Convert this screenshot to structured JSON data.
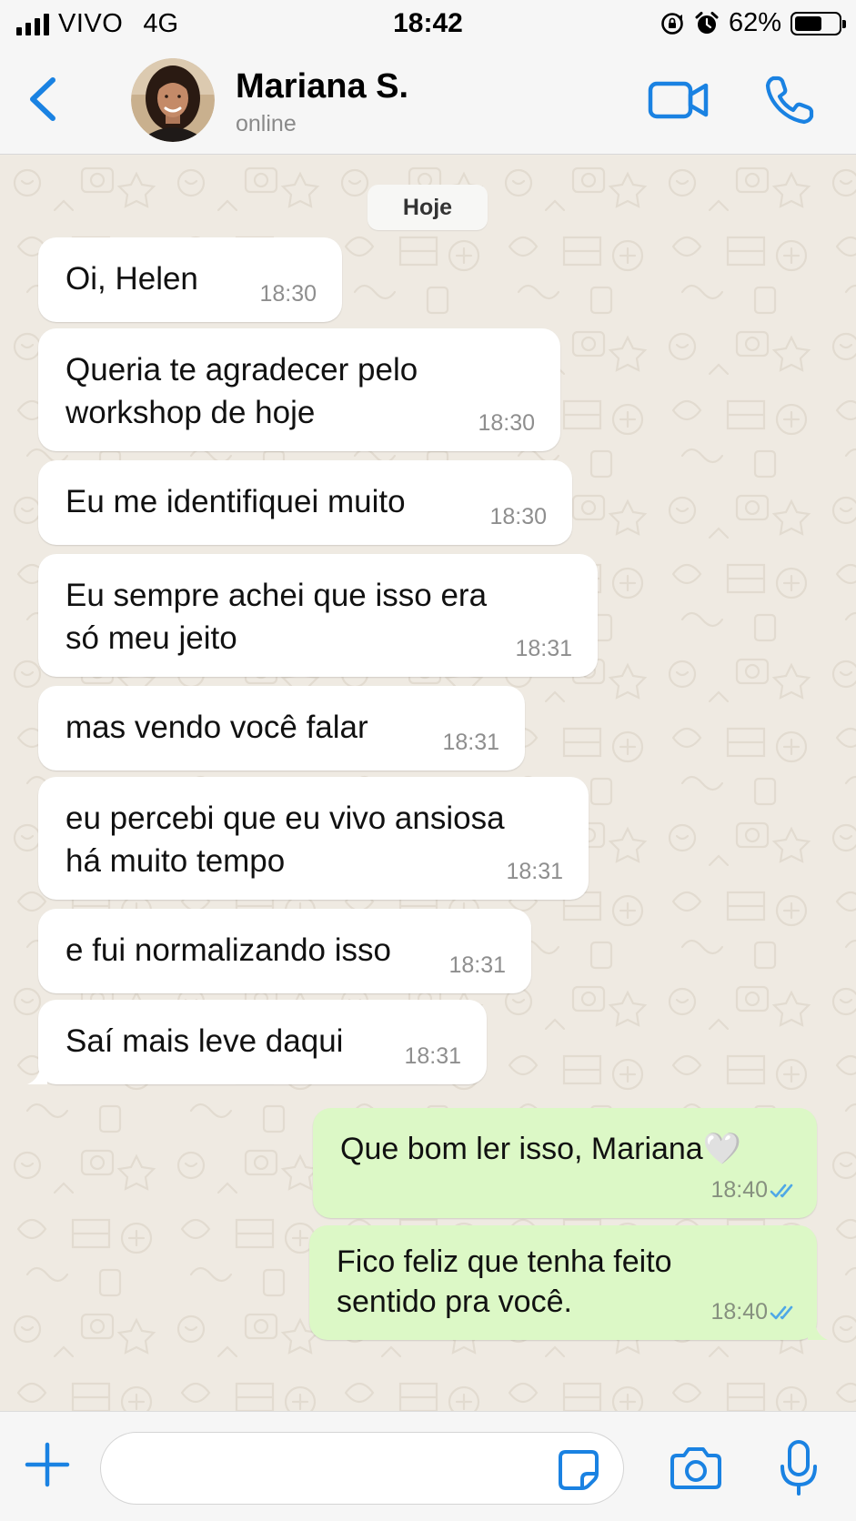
{
  "status_bar": {
    "carrier": "VIVO",
    "network": "4G",
    "time": "18:42",
    "battery_percent": "62%",
    "battery_level": 0.62,
    "icons": [
      "signal-icon",
      "rotation-lock-icon",
      "alarm-icon",
      "battery-icon"
    ]
  },
  "header": {
    "contact_name": "Mariana S.",
    "contact_status": "online",
    "icons": [
      "back-chevron-icon",
      "avatar",
      "video-camera-icon",
      "phone-icon"
    ]
  },
  "chat": {
    "date_label": "Hoje",
    "incoming": [
      {
        "lines": [
          "Oi, Helen"
        ],
        "time": "18:30"
      },
      {
        "lines": [
          "Queria te agradecer pelo",
          "workshop de hoje"
        ],
        "time": "18:30"
      },
      {
        "lines": [
          "Eu me identifiquei muito"
        ],
        "time": "18:30"
      },
      {
        "lines": [
          "Eu sempre achei que isso era",
          "só meu jeito"
        ],
        "time": "18:31"
      },
      {
        "lines": [
          "mas vendo você falar"
        ],
        "time": "18:31"
      },
      {
        "lines": [
          "eu percebi que eu vivo ansiosa",
          "há muito tempo"
        ],
        "time": "18:31"
      },
      {
        "lines": [
          "e fui normalizando isso"
        ],
        "time": "18:31"
      },
      {
        "lines": [
          "Saí mais leve daqui"
        ],
        "time": "18:31"
      }
    ],
    "outgoing": [
      {
        "lines": [
          "Que bom ler isso, Mariana🤍"
        ],
        "time": "18:40",
        "status": "read"
      },
      {
        "lines": [
          "Fico feliz que tenha feito",
          "sentido pra você."
        ],
        "time": "18:40",
        "status": "read"
      }
    ]
  },
  "input_bar": {
    "placeholder": "",
    "icons": [
      "plus-icon",
      "sticker-icon",
      "camera-icon",
      "microphone-icon"
    ]
  },
  "colors": {
    "accent": "#1a82e2",
    "outgoing_bubble": "#dcf8c6",
    "incoming_bubble": "#ffffff",
    "chat_background": "#efeae2",
    "read_ticks": "#4fa8e6"
  }
}
